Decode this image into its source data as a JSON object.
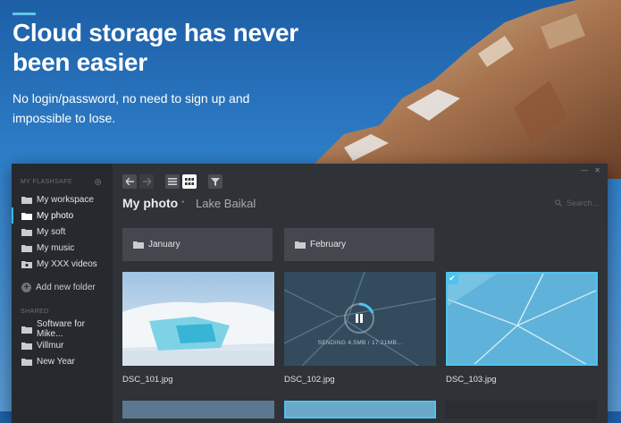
{
  "hero": {
    "title": "Cloud storage has never been easier",
    "subtitle": "No login/password, no need to sign up and impossible to lose."
  },
  "sidebar": {
    "section_main": "MY FLASHSAFE",
    "items": [
      {
        "label": "My workspace",
        "active": false
      },
      {
        "label": "My photo",
        "active": true
      },
      {
        "label": "My soft",
        "active": false
      },
      {
        "label": "My music",
        "active": false
      },
      {
        "label": "My XXX videos",
        "active": false
      }
    ],
    "add_folder": "Add new folder",
    "section_shared": "SHARED",
    "shared_items": [
      {
        "label": "Software for Mike..."
      },
      {
        "label": "Villmur"
      },
      {
        "label": "New Year"
      }
    ]
  },
  "breadcrumb": {
    "root": "My photo",
    "current": "Lake Baikal"
  },
  "search": {
    "placeholder": "Search..."
  },
  "folders": [
    {
      "label": "January"
    },
    {
      "label": "February"
    }
  ],
  "files": [
    {
      "name": "DSC_101.jpg",
      "state": "normal"
    },
    {
      "name": "DSC_102.jpg",
      "state": "uploading",
      "status": "SENDING 4.5MB / 17.21MB..."
    },
    {
      "name": "DSC_103.jpg",
      "state": "selected"
    }
  ],
  "colors": {
    "accent": "#4fc3ec",
    "window_bg": "#2f3237",
    "sidebar_bg": "#26292d"
  }
}
